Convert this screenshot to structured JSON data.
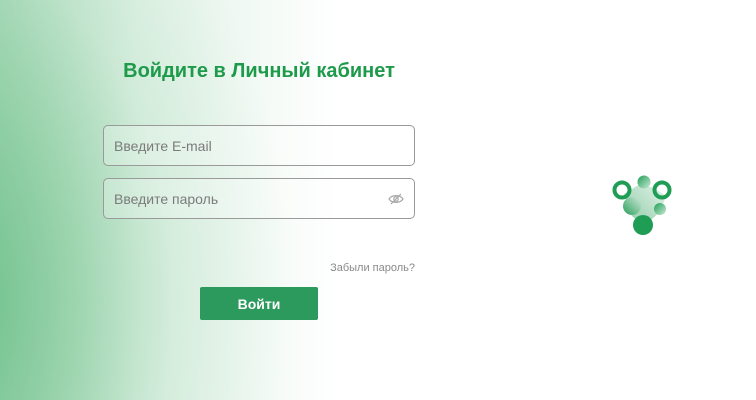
{
  "login": {
    "title": "Войдите в Личный кабинет",
    "email_placeholder": "Введите E-mail",
    "password_placeholder": "Введите пароль",
    "forgot_link": "Забыли пароль?",
    "submit_label": "Войти"
  },
  "colors": {
    "accent": "#1e9a4b",
    "button": "#2c9a5c",
    "gradient": "#60ba80"
  },
  "icons": {
    "password_toggle": "eye-hidden-icon",
    "logo": "molecule-logo-icon"
  }
}
